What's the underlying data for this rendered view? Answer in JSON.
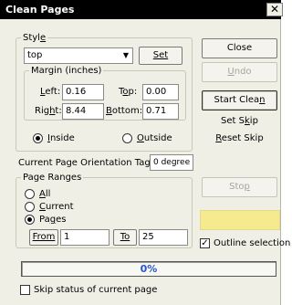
{
  "window": {
    "title": "Clean Pages",
    "close_glyph": "✕"
  },
  "style": {
    "legend": "Style",
    "legend_accesskey_index": 4,
    "selected": "top",
    "set_label": "Set",
    "margin": {
      "legend": "Margin (inches)",
      "left_label": "Left:",
      "left_value": "0.16",
      "top_label": "Top:",
      "top_value": "0.00",
      "right_label": "Right:",
      "right_value": "8.44",
      "bottom_label": "Bottom:",
      "bottom_value": "0.71"
    },
    "inside_label": "Inside",
    "inside_checked": true,
    "outside_label": "Outside",
    "outside_checked": false
  },
  "orientation": {
    "label": "Current Page Orientation Tag:",
    "value": "0 degree"
  },
  "page_ranges": {
    "legend": "Page Ranges",
    "options": [
      {
        "label": "All",
        "checked": false
      },
      {
        "label": "Current",
        "checked": false
      },
      {
        "label": "Pages",
        "checked": true
      }
    ],
    "from_label": "From",
    "from_value": "1",
    "to_label": "To",
    "to_value": "25"
  },
  "buttons": {
    "close": "Close",
    "undo": "Undo",
    "start_clean": "Start Clean",
    "set_skip": "Set Skip",
    "reset_skip": "Reset Skip",
    "stop": "Stop"
  },
  "status_color": "#f6ea8e",
  "outline_selection": {
    "label": "Outline selection",
    "checked": true
  },
  "progress": {
    "text": "0%",
    "value": 0
  },
  "skip_status": {
    "label": "Skip status of current page",
    "checked": false
  }
}
